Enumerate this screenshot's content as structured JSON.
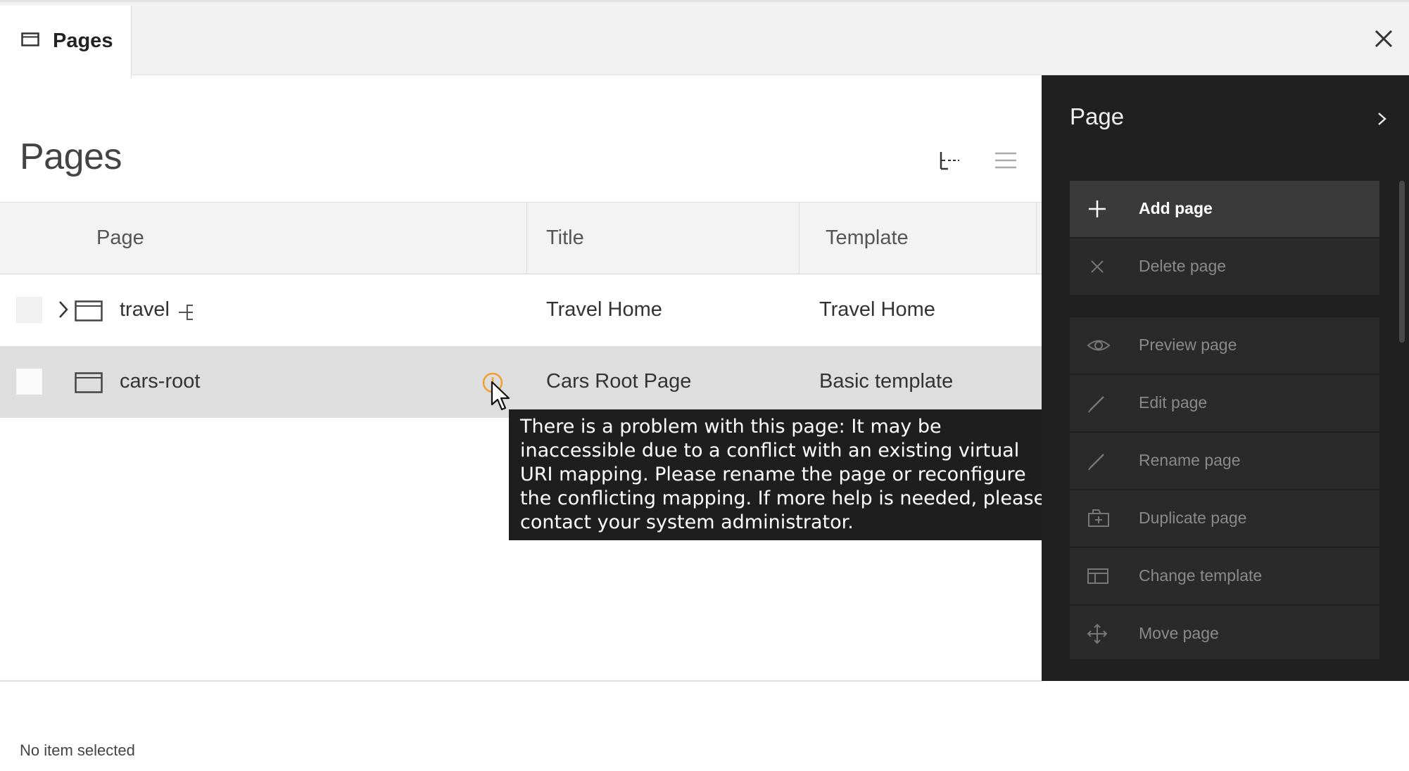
{
  "tabs": [
    {
      "label": "Pages",
      "icon": "page-icon"
    }
  ],
  "heading": "Pages",
  "columns": [
    "Page",
    "Title",
    "Template"
  ],
  "rows": [
    {
      "name": "travel",
      "title": "Travel Home",
      "template": "Travel Home",
      "expandable": true,
      "badge": "link-icon"
    },
    {
      "name": "cars-root",
      "title": "Cars Root Page",
      "template": "Basic template",
      "warning": true,
      "selected": true
    }
  ],
  "tooltip": "There is a problem with this page: It may be inaccessible due to a conflict with an existing virtual URI mapping. Please rename the page or reconfigure the conflicting mapping. If more help is needed, please contact your system administrator.",
  "status": "No item selected",
  "panel": {
    "title": "Page",
    "actions": [
      {
        "label": "Add page",
        "icon": "plus-icon",
        "enabled": true
      },
      {
        "label": "Delete page",
        "icon": "x-icon",
        "enabled": false
      },
      {
        "label": "Preview page",
        "icon": "eye-icon",
        "enabled": false
      },
      {
        "label": "Edit page",
        "icon": "pencil-icon",
        "enabled": false
      },
      {
        "label": "Rename page",
        "icon": "pencil-icon",
        "enabled": false
      },
      {
        "label": "Duplicate page",
        "icon": "duplicate-icon",
        "enabled": false
      },
      {
        "label": "Change template",
        "icon": "template-icon",
        "enabled": false
      },
      {
        "label": "Move page",
        "icon": "move-icon",
        "enabled": false
      }
    ]
  },
  "colors": {
    "panel_bg": "#202020",
    "warning": "#f0a030",
    "tooltip_bg": "#1e1e1e"
  }
}
